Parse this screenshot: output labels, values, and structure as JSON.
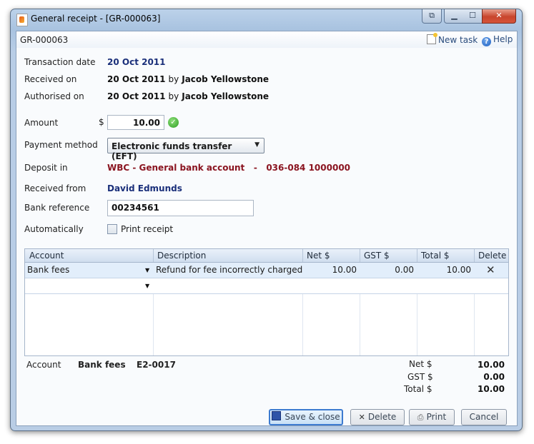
{
  "window": {
    "title": "General receipt - [GR-000063]"
  },
  "taskbar": {
    "doc_id": "GR-000063",
    "new_task_label": "New task",
    "help_label": "Help"
  },
  "form": {
    "transaction_date": {
      "label": "Transaction date",
      "value": "20 Oct 2011"
    },
    "received_on": {
      "label": "Received on",
      "value": "20 Oct 2011",
      "by": "by",
      "user": "Jacob Yellowstone"
    },
    "authorised_on": {
      "label": "Authorised on",
      "value": "20 Oct 2011",
      "by": "by",
      "user": "Jacob Yellowstone"
    },
    "amount": {
      "label": "Amount",
      "currency": "$",
      "value": "10.00"
    },
    "payment_method": {
      "label": "Payment method",
      "value": "Electronic funds transfer (EFT)"
    },
    "deposit_in": {
      "label": "Deposit in",
      "value": "WBC - General bank account   -   036-084 1000000"
    },
    "received_from": {
      "label": "Received from",
      "value": "David Edmunds"
    },
    "bank_reference": {
      "label": "Bank reference",
      "value": "00234561"
    },
    "automatically": {
      "label": "Automatically",
      "checkbox_label": "Print receipt",
      "checked": false
    }
  },
  "grid": {
    "headers": {
      "account": "Account",
      "description": "Description",
      "net": "Net $",
      "gst": "GST $",
      "total": "Total $",
      "delete": "Delete"
    },
    "rows": [
      {
        "account": "Bank fees",
        "description": "Refund for fee incorrectly charged",
        "net": "10.00",
        "gst": "0.00",
        "total": "10.00"
      }
    ]
  },
  "summary": {
    "account_label": "Account",
    "account_name": "Bank fees",
    "account_code": "E2-0017",
    "net_label": "Net $",
    "net_value": "10.00",
    "gst_label": "GST $",
    "gst_value": "0.00",
    "total_label": "Total $",
    "total_value": "10.00"
  },
  "buttons": {
    "save_close": "Save & close",
    "delete": "Delete",
    "print": "Print",
    "cancel": "Cancel"
  },
  "colors": {
    "link_blue": "#1a2f7a",
    "maroon": "#8a1420",
    "accent": "#3d7bd0"
  }
}
